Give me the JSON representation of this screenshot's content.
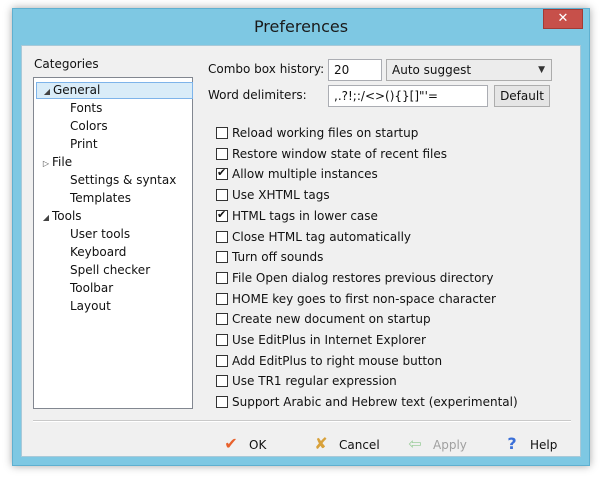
{
  "window": {
    "title": "Preferences",
    "close_glyph": "✕"
  },
  "categories": {
    "label": "Categories",
    "items": [
      {
        "label": "General",
        "level": 0,
        "expander": "◢",
        "selected": true
      },
      {
        "label": "Fonts",
        "level": 1
      },
      {
        "label": "Colors",
        "level": 1
      },
      {
        "label": "Print",
        "level": 1
      },
      {
        "label": "File",
        "level": 0,
        "expander": "▷"
      },
      {
        "label": "Settings & syntax",
        "level": 1
      },
      {
        "label": "Templates",
        "level": 1
      },
      {
        "label": "Tools",
        "level": 0,
        "expander": "◢"
      },
      {
        "label": "User tools",
        "level": 1
      },
      {
        "label": "Keyboard",
        "level": 1
      },
      {
        "label": "Spell checker",
        "level": 1
      },
      {
        "label": "Toolbar",
        "level": 1
      },
      {
        "label": "Layout",
        "level": 1
      }
    ]
  },
  "combo_history": {
    "label": "Combo box history:",
    "value": "20",
    "mode": "Auto suggest"
  },
  "word_delimiters": {
    "label": "Word delimiters:",
    "value": ",.?!;:/<>(){}[]\"'=",
    "default_label": "Default"
  },
  "options": [
    {
      "label": "Reload working files on startup",
      "checked": false
    },
    {
      "label": "Restore window state of recent files",
      "checked": false
    },
    {
      "label": "Allow multiple instances",
      "checked": true
    },
    {
      "label": "Use XHTML tags",
      "checked": false
    },
    {
      "label": "HTML tags in lower case",
      "checked": true
    },
    {
      "label": "Close HTML tag automatically",
      "checked": false
    },
    {
      "label": "Turn off sounds",
      "checked": false
    },
    {
      "label": "File Open dialog restores previous directory",
      "checked": false
    },
    {
      "label": "HOME key goes to first non-space character",
      "checked": false
    },
    {
      "label": "Create new document on startup",
      "checked": false
    },
    {
      "label": "Use EditPlus in Internet Explorer",
      "checked": false
    },
    {
      "label": "Add EditPlus to right mouse button",
      "checked": false
    },
    {
      "label": "Use TR1 regular expression",
      "checked": false
    },
    {
      "label": "Support Arabic and Hebrew text (experimental)",
      "checked": false
    }
  ],
  "buttons": {
    "ok": {
      "label": "OK",
      "icon": "check-icon",
      "color": "#e8612c"
    },
    "cancel": {
      "label": "Cancel",
      "icon": "cross-icon",
      "color": "#d8a13a"
    },
    "apply": {
      "label": "Apply",
      "icon": "arrow-icon",
      "color": "#9fcf9f",
      "disabled": true
    },
    "help": {
      "label": "Help",
      "icon": "question-icon",
      "color": "#3a6fd8"
    }
  }
}
